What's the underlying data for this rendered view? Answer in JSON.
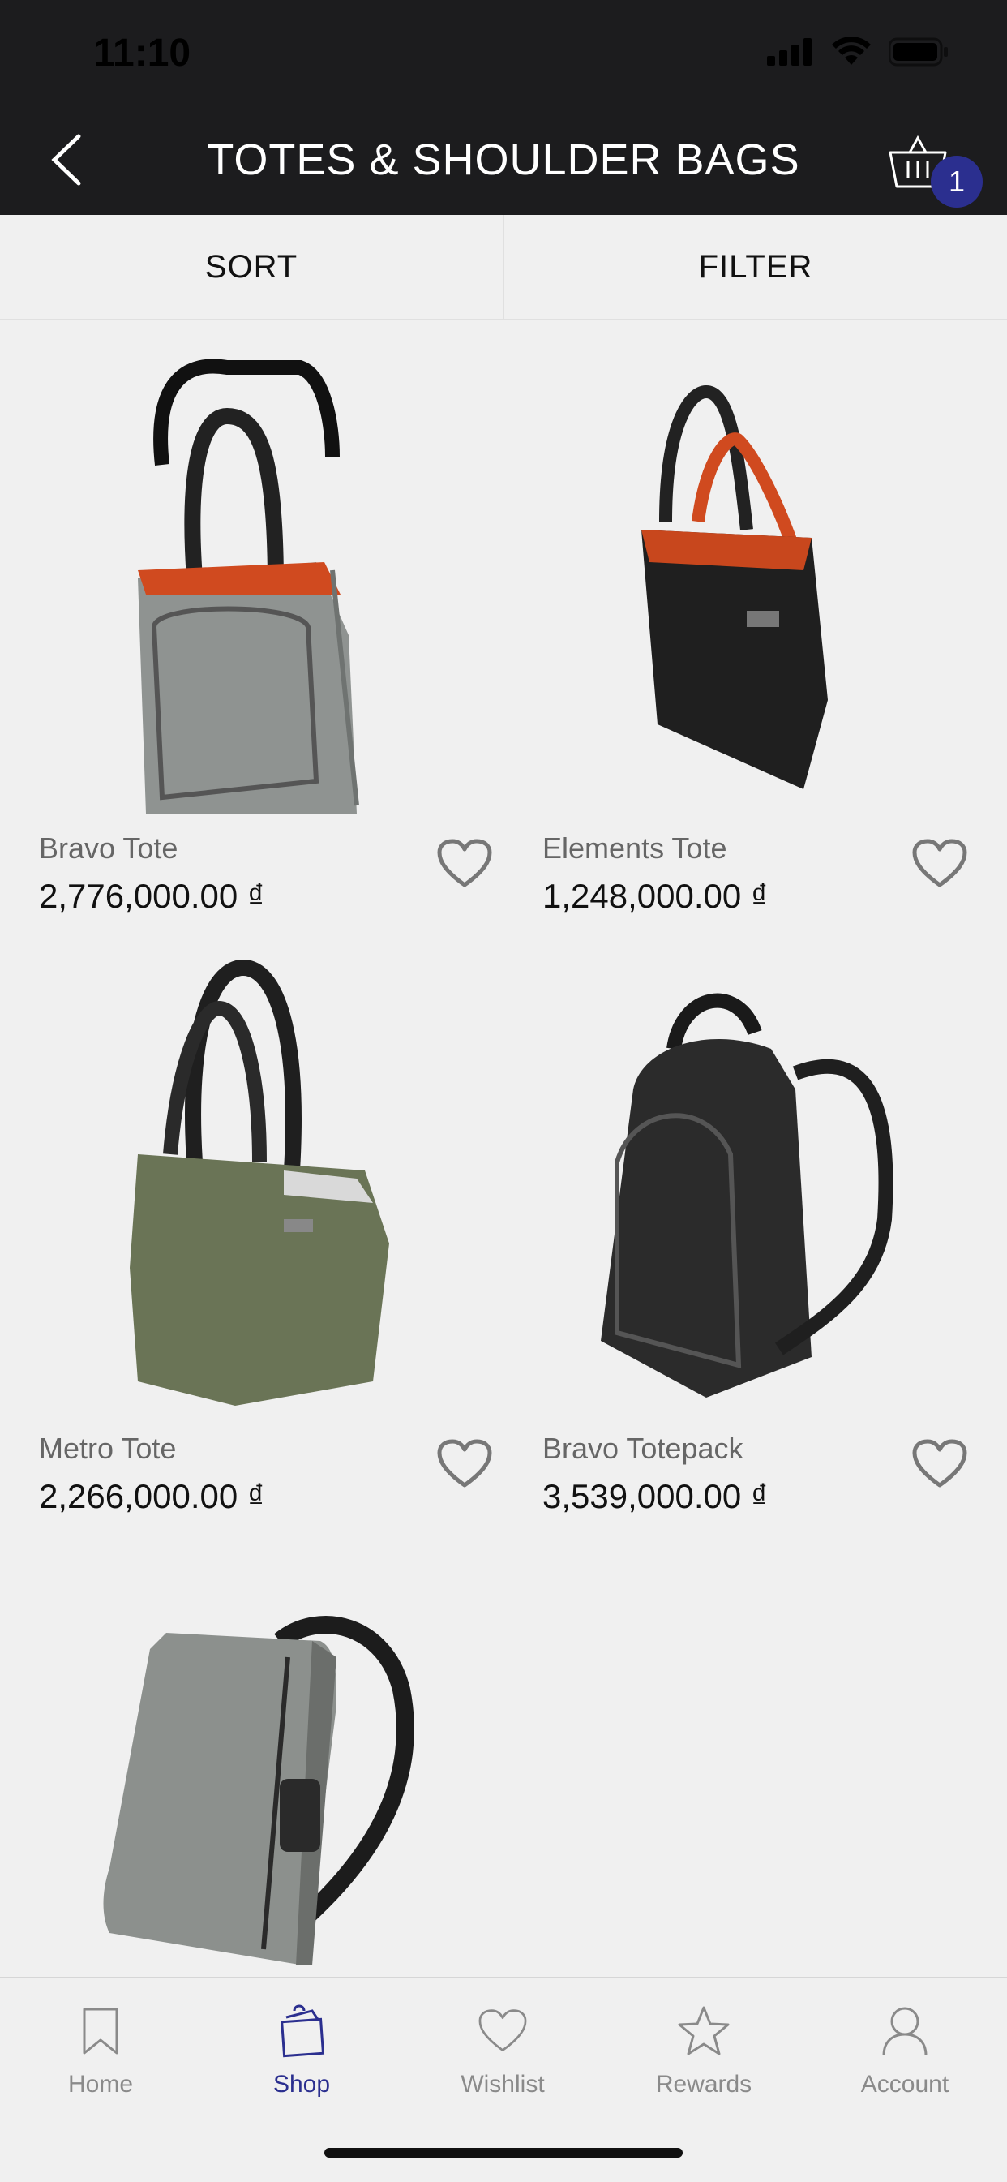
{
  "status": {
    "time": "11:10"
  },
  "header": {
    "title": "TOTES & SHOULDER BAGS",
    "cart_count": "1"
  },
  "toolbar": {
    "sort_label": "SORT",
    "filter_label": "FILTER"
  },
  "products": [
    {
      "name": "Bravo Tote",
      "price": "2,776,000.00 ₫"
    },
    {
      "name": "Elements Tote",
      "price": "1,248,000.00 ₫"
    },
    {
      "name": "Metro Tote",
      "price": "2,266,000.00 ₫"
    },
    {
      "name": "Bravo Totepack",
      "price": "3,539,000.00 ₫"
    }
  ],
  "tabs": [
    {
      "label": "Home",
      "icon": "bookmark-icon"
    },
    {
      "label": "Shop",
      "icon": "shopping-bag-icon"
    },
    {
      "label": "Wishlist",
      "icon": "heart-icon"
    },
    {
      "label": "Rewards",
      "icon": "star-icon"
    },
    {
      "label": "Account",
      "icon": "person-icon"
    }
  ],
  "colors": {
    "accent": "#2b2f8f",
    "header_bg": "#1c1c1e",
    "page_bg": "#f0f0f0"
  }
}
